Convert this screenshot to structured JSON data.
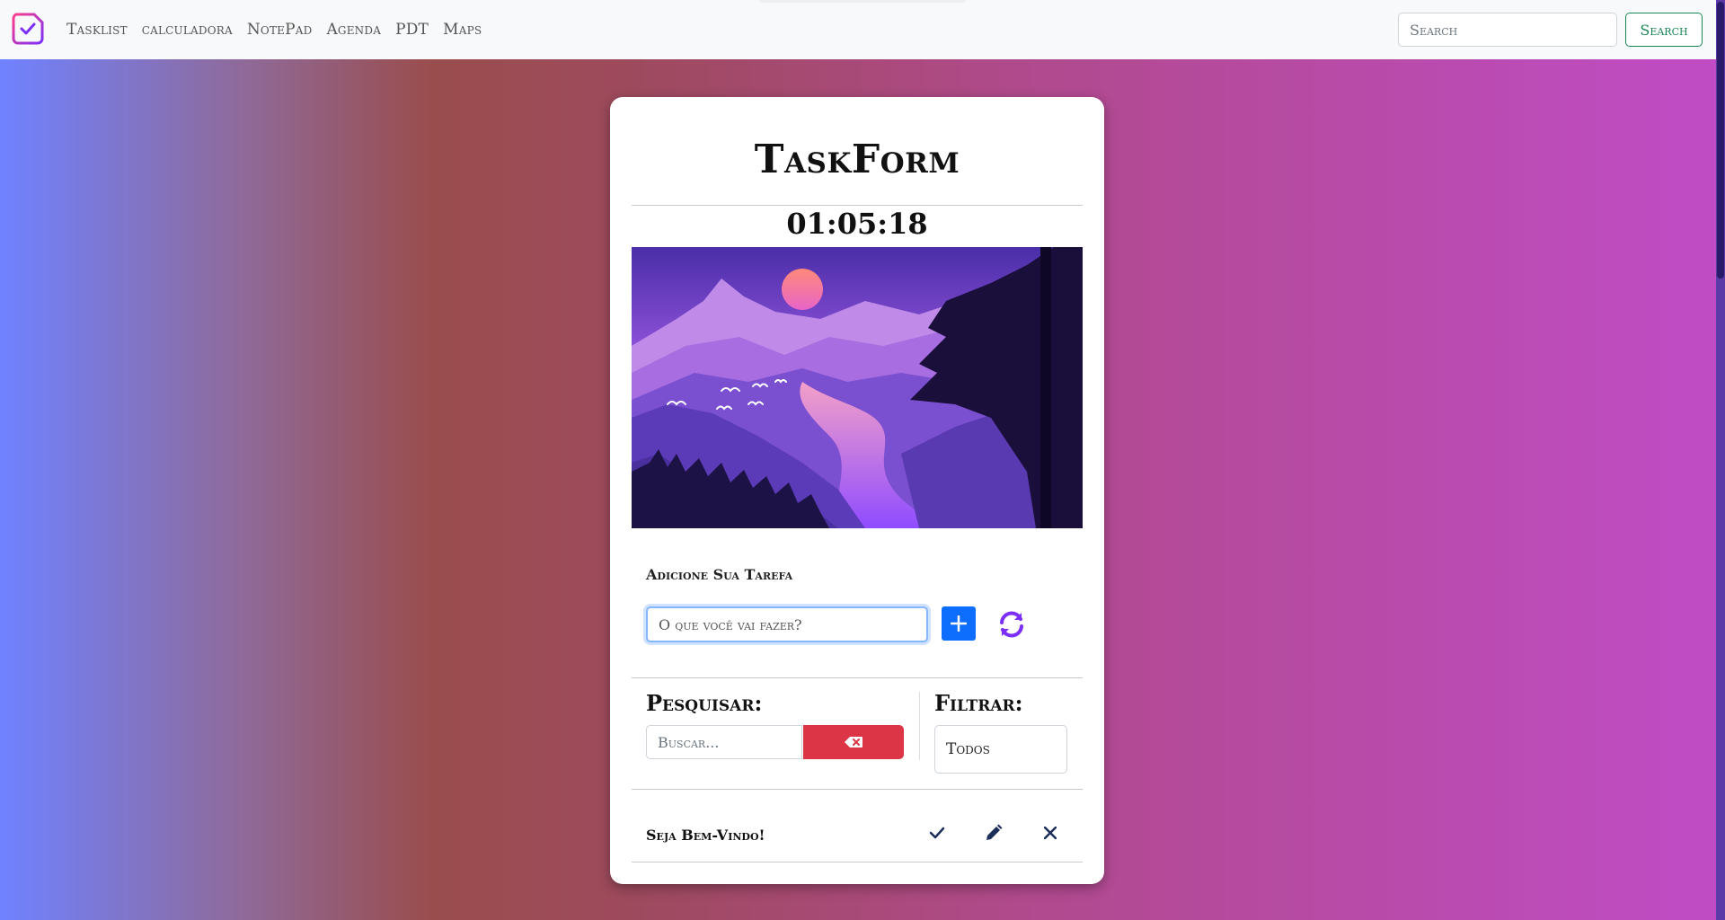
{
  "navbar": {
    "links": [
      "Tasklist",
      "calculadora",
      "NotePad",
      "Agenda",
      "PDT",
      "Maps"
    ],
    "search_placeholder": "Search",
    "search_button": "Search"
  },
  "card": {
    "title": "TaskForm",
    "clock": "01:05:18",
    "add_label": "Adicione Sua Tarefa",
    "task_placeholder": "O que você vai fazer?",
    "search_title": "Pesquisar:",
    "search_placeholder": "Buscar...",
    "filter_title": "Filtrar:",
    "filter_value": "Todos",
    "tasks": [
      {
        "text": "Seja Bem-Vindo!"
      }
    ]
  },
  "colors": {
    "primary": "#0d6efd",
    "danger": "#dc3545",
    "success": "#198754",
    "accent_purple": "#7b2ff7"
  }
}
